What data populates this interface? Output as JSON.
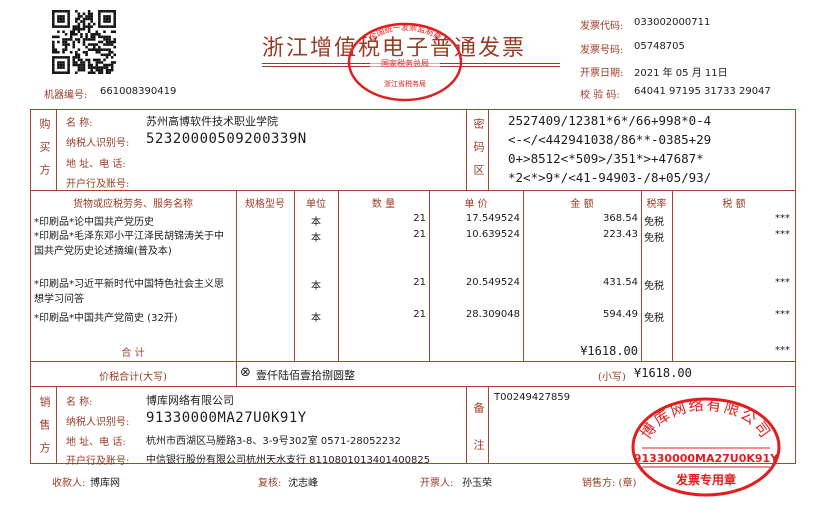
{
  "invoice": {
    "title": "浙江增值税电子普通发票",
    "machine_label": "机器编号:",
    "machine_no": "661008390419",
    "code_label": "发票代码:",
    "code": "033002000711",
    "number_label": "发票号码:",
    "number": "05748705",
    "date_label": "开票日期:",
    "date": "2021 年 05 月 11日",
    "check_label": "校  验 码:",
    "check_code": "64041 97195 31733 29047"
  },
  "buyer": {
    "section_label": "购买方",
    "name_label": "名      称:",
    "name": "苏州高博软件技术职业学院",
    "tax_label": "纳税人识别号:",
    "tax_id": "52320000509200339N",
    "addr_label": "地 址、电 话:",
    "addr": "",
    "bank_label": "开户行及账号:",
    "bank": ""
  },
  "cipher": {
    "label": "密码区",
    "lines": [
      "2527409/12381*6*/66+998*0-4",
      "<-</<442941038/86**-0385+29",
      "0+>8512<*509>/351*>+47687*",
      "*2<*>9*/<41-94903-/8+05/93/"
    ]
  },
  "items": {
    "headers": [
      "货物或应税劳务、服务名称",
      "规格型号",
      "单位",
      "数  量",
      "单  价",
      "金  额",
      "税率",
      "税  额"
    ],
    "rows": [
      {
        "name": "*印刷品*论中国共产党历史",
        "unit": "本",
        "qty": "21",
        "price": "17.549524",
        "amount": "368.54",
        "rate": "免税",
        "tax": "***"
      },
      {
        "name": "*印刷品*毛泽东邓小平江泽民胡锦涛关于中国共产党历史论述摘编(普及本)",
        "unit": "本",
        "qty": "21",
        "price": "10.639524",
        "amount": "223.43",
        "rate": "免税",
        "tax": "***"
      },
      {
        "name": "*印刷品*习近平新时代中国特色社会主义思想学习问答",
        "unit": "本",
        "qty": "21",
        "price": "20.549524",
        "amount": "431.54",
        "rate": "免税",
        "tax": "***"
      },
      {
        "name": "*印刷品*中国共产党简史 (32开)",
        "unit": "本",
        "qty": "21",
        "price": "28.309048",
        "amount": "594.49",
        "rate": "免税",
        "tax": "***"
      }
    ],
    "total_label": "合      计",
    "total_amount": "¥1618.00",
    "total_tax": "***"
  },
  "total_words": {
    "label": "价税合计(大写)",
    "symbol": "⊗",
    "words": "壹仟陆佰壹拾捌圆整",
    "small_label": "(小写)",
    "small": "¥1618.00"
  },
  "seller": {
    "section_label": "销售方",
    "name_label": "名      称:",
    "name": "博库网络有限公司",
    "tax_label": "纳税人识别号:",
    "tax_id": "91330000MA27U0K91Y",
    "addr_label": "地 址、电 话:",
    "addr": "杭州市西湖区马塍路3-8、3-9号302室 0571-28052232",
    "bank_label": "开户行及账号:",
    "bank": "中信银行股份有限公司杭州天水支行 8110801013401400825"
  },
  "remarks": {
    "label": "备注",
    "text": "T00249427859"
  },
  "footer": {
    "payee_label": "收款人:",
    "payee": "博库网",
    "reviewer_label": "复核:",
    "reviewer": "沈志峰",
    "drawer_label": "开票人:",
    "drawer": "孙玉荣",
    "seller_label": "销售方: (章)"
  },
  "stamps": {
    "tax_top": "全国统一发票监制章",
    "tax_mid": "国家税务总局",
    "tax_bottom": "浙江省税务局",
    "seller_ring": "博库网络有限公司",
    "seller_id": "91330000MA27U0K91Y",
    "seller_bottom": "发票专用章"
  },
  "colors": {
    "frame": "#a7452e",
    "label": "#9a3b26",
    "stamp": "#e21d1d",
    "text": "#1c1c1c"
  }
}
